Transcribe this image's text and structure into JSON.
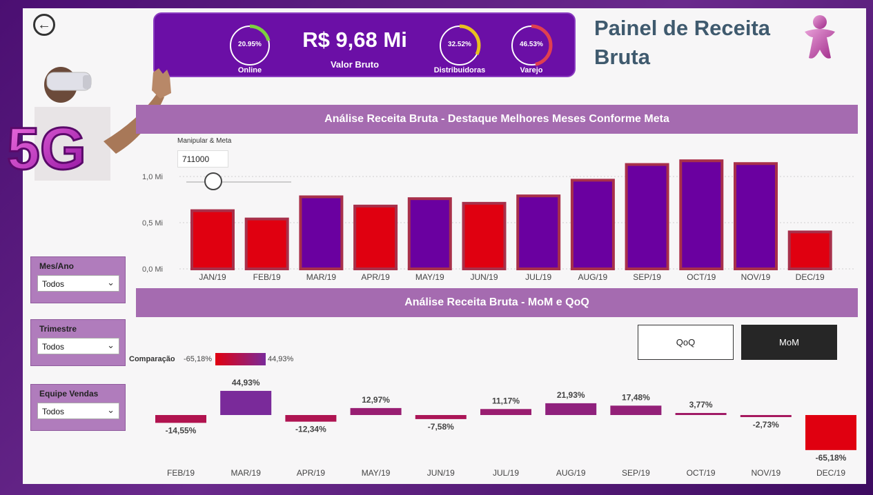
{
  "header": {
    "title": "Painel de Receita Bruta",
    "kpi": {
      "main_value": "R$ 9,68 Mi",
      "main_label": "Valor Bruto",
      "gauges": [
        {
          "label": "Online",
          "value": "20.95%",
          "pct": 20.95,
          "color": "#7dd040"
        },
        {
          "label": "Distribuidoras",
          "value": "32.52%",
          "pct": 32.52,
          "color": "#e8c020"
        },
        {
          "label": "Varejo",
          "value": "46.53%",
          "pct": 46.53,
          "color": "#e04050"
        }
      ]
    }
  },
  "promo": {
    "badge": "5G"
  },
  "slicers": [
    {
      "title": "Mes/Ano",
      "value": "Todos"
    },
    {
      "title": "Trimestre",
      "value": "Todos"
    },
    {
      "title": "Equipe Vendas",
      "value": "Todos"
    }
  ],
  "manipulator": {
    "label": "Manipular & Meta",
    "value": "711000"
  },
  "section1": {
    "title": "Análise Receita Bruta - Destaque Melhores Meses Conforme Meta"
  },
  "section2": {
    "title": "Análise Receita Bruta - MoM e QoQ"
  },
  "toggles": {
    "qoq": "QoQ",
    "mom": "MoM"
  },
  "legend": {
    "label": "Comparação",
    "min": "-65,18%",
    "max": "44,93%"
  },
  "colors": {
    "below_goal": "#e00010",
    "above_goal": "#6a00a0",
    "outline": "#a8304a",
    "accent": "#6b0fa6"
  },
  "chart_data": [
    {
      "type": "bar",
      "title": "Análise Receita Bruta - Destaque Melhores Meses Conforme Meta",
      "categories": [
        "JAN/19",
        "FEB/19",
        "MAR/19",
        "APR/19",
        "MAY/19",
        "JUN/19",
        "JUL/19",
        "AUG/19",
        "SEP/19",
        "OCT/19",
        "NOV/19",
        "DEC/19"
      ],
      "values": [
        0.63,
        0.54,
        0.78,
        0.68,
        0.76,
        0.71,
        0.79,
        0.96,
        1.13,
        1.17,
        1.14,
        0.4
      ],
      "above_goal": [
        false,
        false,
        true,
        false,
        true,
        false,
        true,
        true,
        true,
        true,
        true,
        false
      ],
      "goal": 0.711,
      "yticks": [
        "0,0 Mi",
        "0,5 Mi",
        "1,0 Mi"
      ],
      "ylim": [
        0,
        1.2
      ],
      "grid": true
    },
    {
      "type": "bar",
      "title": "Análise Receita Bruta - MoM e QoQ",
      "categories": [
        "FEB/19",
        "MAR/19",
        "APR/19",
        "MAY/19",
        "JUN/19",
        "JUL/19",
        "AUG/19",
        "SEP/19",
        "OCT/19",
        "NOV/19",
        "DEC/19"
      ],
      "values": [
        -14.55,
        44.93,
        -12.34,
        12.97,
        -7.58,
        11.17,
        21.93,
        17.48,
        3.77,
        -2.73,
        -65.18
      ],
      "labels": [
        "-14,55%",
        "44,93%",
        "-12,34%",
        "12,97%",
        "-7,58%",
        "11,17%",
        "21,93%",
        "17,48%",
        "3,77%",
        "-2,73%",
        "-65,18%"
      ],
      "ylim": [
        -65.18,
        44.93
      ]
    }
  ]
}
